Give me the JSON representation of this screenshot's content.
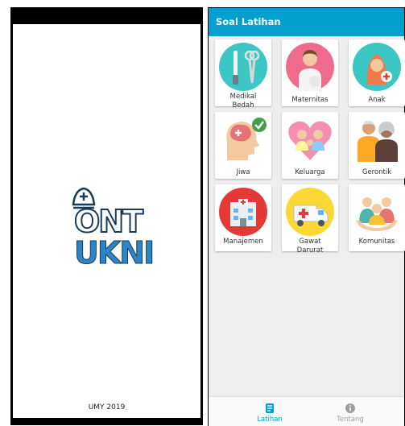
{
  "splash": {
    "logo_line1": "ONT",
    "logo_line2": "UKNI",
    "footer": "UMY 2019"
  },
  "app": {
    "title": "Soal Latihan",
    "categories": [
      {
        "label": "Medikal\nBedah",
        "icon": "surgical-tools-icon"
      },
      {
        "label": "Maternitas",
        "icon": "pregnant-woman-icon"
      },
      {
        "label": "Anak",
        "icon": "baby-icon"
      },
      {
        "label": "Jiwa",
        "icon": "mental-health-icon"
      },
      {
        "label": "Keluarga",
        "icon": "family-heart-icon"
      },
      {
        "label": "Gerontik",
        "icon": "elderly-couple-icon"
      },
      {
        "label": "Manajemen",
        "icon": "hospital-icon"
      },
      {
        "label": "Gawat\nDarurat",
        "icon": "ambulance-icon"
      },
      {
        "label": "Komunitas",
        "icon": "community-icon"
      }
    ],
    "nav": [
      {
        "label": "Latihan",
        "icon": "document-icon",
        "active": true
      },
      {
        "label": "Tentang",
        "icon": "info-icon",
        "active": false
      }
    ],
    "colors": {
      "primary": "#03a0cf",
      "inactive": "#9e9e9e"
    }
  }
}
